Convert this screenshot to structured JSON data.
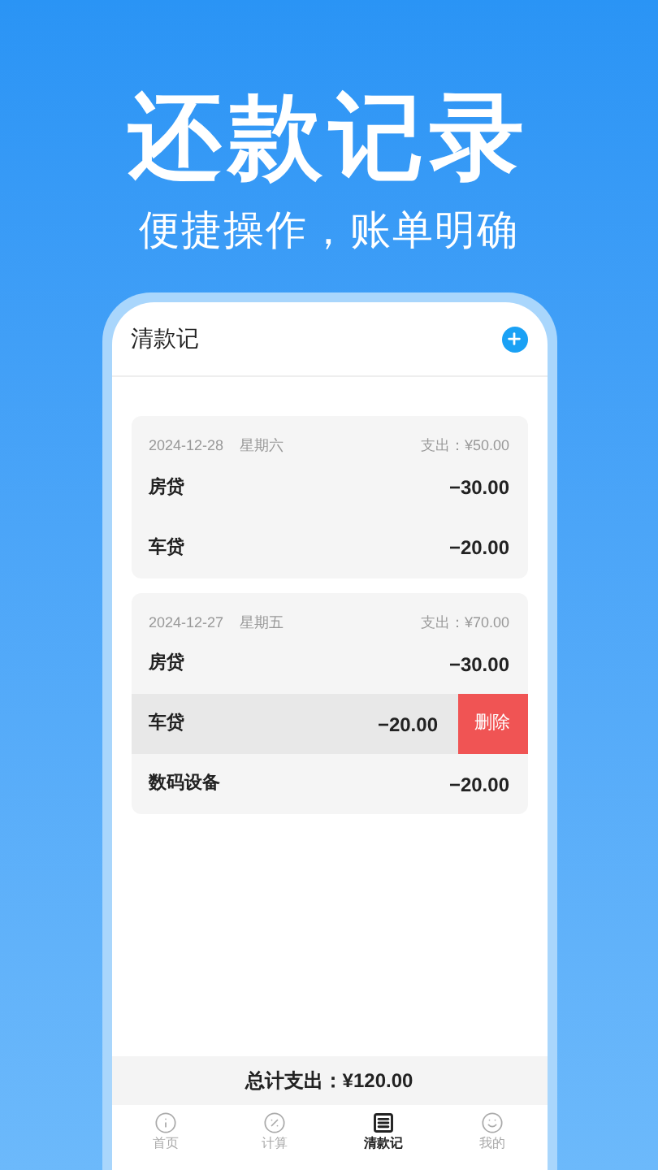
{
  "hero": {
    "title": "还款记录",
    "subtitle": "便捷操作，账单明确"
  },
  "app": {
    "title": "清款记",
    "groups": [
      {
        "date": "2024-12-28",
        "weekday": "星期六",
        "total": "支出：¥50.00",
        "items": [
          {
            "name": "房贷",
            "amount": "−30.00",
            "swiped": false
          },
          {
            "name": "车贷",
            "amount": "−20.00",
            "swiped": false
          }
        ]
      },
      {
        "date": "2024-12-27",
        "weekday": "星期五",
        "total": "支出：¥70.00",
        "items": [
          {
            "name": "房贷",
            "amount": "−30.00",
            "swiped": false
          },
          {
            "name": "车贷",
            "amount": "−20.00",
            "swiped": true,
            "action": "删除"
          },
          {
            "name": "数码设备",
            "amount": "−20.00",
            "swiped": false
          }
        ]
      }
    ],
    "summary": "总计支出：¥120.00",
    "tabs": [
      {
        "label": "首页",
        "selected": false
      },
      {
        "label": "计算",
        "selected": false
      },
      {
        "label": "清款记",
        "selected": true
      },
      {
        "label": "我的",
        "selected": false
      }
    ]
  }
}
